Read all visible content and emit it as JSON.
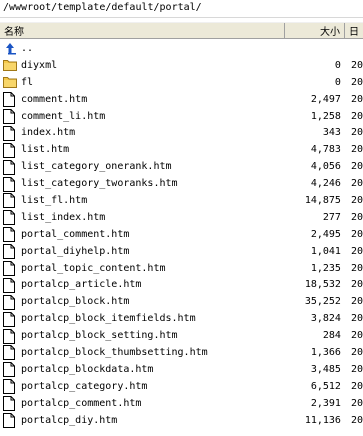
{
  "path": "/wwwroot/template/default/portal/",
  "columns": {
    "name": "名称",
    "size": "大小",
    "date": "日"
  },
  "rows": [
    {
      "name": "..",
      "size": "",
      "date": "",
      "icon": "up-folder-icon",
      "kind": "up"
    },
    {
      "name": "diyxml",
      "size": "0",
      "date": "20",
      "icon": "folder-icon",
      "kind": "folder"
    },
    {
      "name": "fl",
      "size": "0",
      "date": "20",
      "icon": "folder-icon",
      "kind": "folder"
    },
    {
      "name": "comment.htm",
      "size": "2,497",
      "date": "20",
      "icon": "file-icon",
      "kind": "file"
    },
    {
      "name": "comment_li.htm",
      "size": "1,258",
      "date": "20",
      "icon": "file-icon",
      "kind": "file"
    },
    {
      "name": "index.htm",
      "size": "343",
      "date": "20",
      "icon": "file-icon",
      "kind": "file"
    },
    {
      "name": "list.htm",
      "size": "4,783",
      "date": "20",
      "icon": "file-icon",
      "kind": "file"
    },
    {
      "name": "list_category_onerank.htm",
      "size": "4,056",
      "date": "20",
      "icon": "file-icon",
      "kind": "file"
    },
    {
      "name": "list_category_tworanks.htm",
      "size": "4,246",
      "date": "20",
      "icon": "file-icon",
      "kind": "file"
    },
    {
      "name": "list_fl.htm",
      "size": "14,875",
      "date": "20",
      "icon": "file-icon",
      "kind": "file"
    },
    {
      "name": "list_index.htm",
      "size": "277",
      "date": "20",
      "icon": "file-icon",
      "kind": "file"
    },
    {
      "name": "portal_comment.htm",
      "size": "2,495",
      "date": "20",
      "icon": "file-icon",
      "kind": "file"
    },
    {
      "name": "portal_diyhelp.htm",
      "size": "1,041",
      "date": "20",
      "icon": "file-icon",
      "kind": "file"
    },
    {
      "name": "portal_topic_content.htm",
      "size": "1,235",
      "date": "20",
      "icon": "file-icon",
      "kind": "file"
    },
    {
      "name": "portalcp_article.htm",
      "size": "18,532",
      "date": "20",
      "icon": "file-icon",
      "kind": "file"
    },
    {
      "name": "portalcp_block.htm",
      "size": "35,252",
      "date": "20",
      "icon": "file-icon",
      "kind": "file"
    },
    {
      "name": "portalcp_block_itemfields.htm",
      "size": "3,824",
      "date": "20",
      "icon": "file-icon",
      "kind": "file"
    },
    {
      "name": "portalcp_block_setting.htm",
      "size": "284",
      "date": "20",
      "icon": "file-icon",
      "kind": "file"
    },
    {
      "name": "portalcp_block_thumbsetting.htm",
      "size": "1,366",
      "date": "20",
      "icon": "file-icon",
      "kind": "file"
    },
    {
      "name": "portalcp_blockdata.htm",
      "size": "3,485",
      "date": "20",
      "icon": "file-icon",
      "kind": "file"
    },
    {
      "name": "portalcp_category.htm",
      "size": "6,512",
      "date": "20",
      "icon": "file-icon",
      "kind": "file"
    },
    {
      "name": "portalcp_comment.htm",
      "size": "2,391",
      "date": "20",
      "icon": "file-icon",
      "kind": "file"
    },
    {
      "name": "portalcp_diy.htm",
      "size": "11,136",
      "date": "20",
      "icon": "file-icon",
      "kind": "file"
    }
  ],
  "colors": {
    "header_bg": "#ece9d8",
    "folder": "#f5c84a",
    "up_arrow": "#1a54c4"
  }
}
